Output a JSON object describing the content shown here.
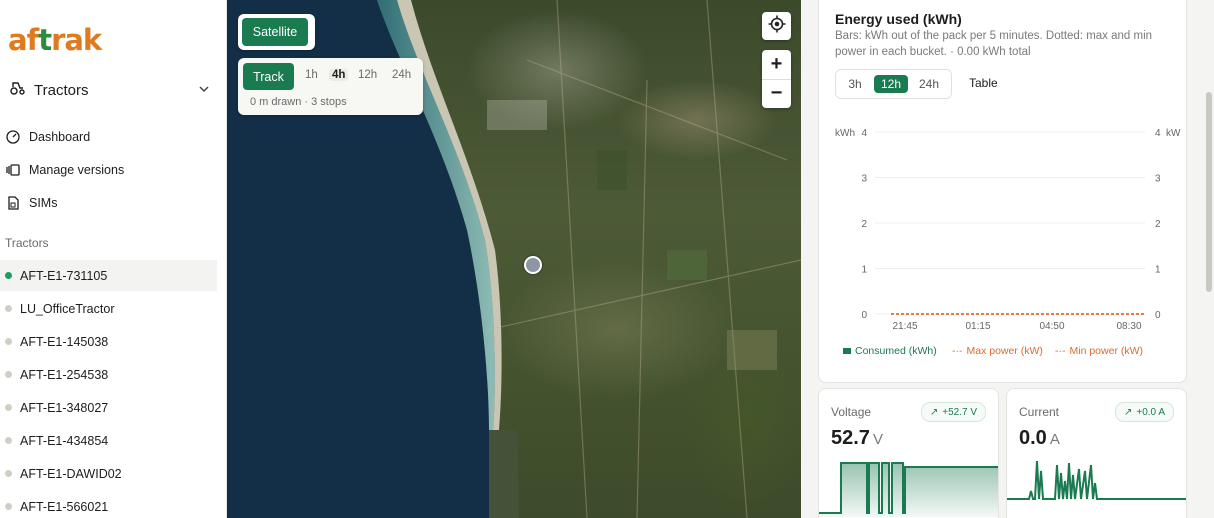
{
  "sidebar": {
    "logo": {
      "part_orange_1": "af",
      "part_green": "t",
      "part_orange_2": "rak"
    },
    "org_label": "Tractors",
    "nav": [
      {
        "label": "Dashboard",
        "icon": "speedometer-icon"
      },
      {
        "label": "Manage versions",
        "icon": "versions-icon"
      },
      {
        "label": "SIMs",
        "icon": "sim-card-icon"
      }
    ],
    "section_title": "Tractors",
    "tractors": [
      {
        "name": "AFT-E1-731105",
        "online": true,
        "selected": true
      },
      {
        "name": "LU_OfficeTractor",
        "online": false
      },
      {
        "name": "AFT-E1-145038",
        "online": false
      },
      {
        "name": "AFT-E1-254538",
        "online": false
      },
      {
        "name": "AFT-E1-348027",
        "online": false
      },
      {
        "name": "AFT-E1-434854",
        "online": false
      },
      {
        "name": "AFT-E1-DAWID02",
        "online": false
      },
      {
        "name": "AFT-E1-566021",
        "online": false
      }
    ]
  },
  "map": {
    "satellite_label": "Satellite",
    "track_label": "Track",
    "ranges": [
      "1h",
      "4h",
      "12h",
      "24h"
    ],
    "selected_range": "4h",
    "track_status": "0 m drawn · 3 stops",
    "zoom_in": "+",
    "zoom_out": "−"
  },
  "energy": {
    "title": "Energy used (kWh)",
    "description": "Bars: kWh out of the pack per 5 minutes. Dotted: max and min power in each bucket. · 0.00 kWh total",
    "ranges": [
      "3h",
      "12h",
      "24h"
    ],
    "selected_range": "12h",
    "table_label": "Table",
    "chart_data": {
      "type": "bar",
      "x_ticks": [
        "21:45",
        "01:15",
        "04:50",
        "08:30"
      ],
      "ylabel_left": "kWh",
      "ylabel_right": "kW",
      "y_ticks_left": [
        "0",
        "1",
        "2",
        "3",
        "4"
      ],
      "y_ticks_right": [
        "0",
        "1",
        "2",
        "3",
        "4"
      ],
      "ylim": [
        0,
        4
      ],
      "series": [
        {
          "name": "Consumed (kWh)",
          "type": "bar",
          "color": "#1a7a50",
          "values": [
            0
          ]
        },
        {
          "name": "Max power (kW)",
          "type": "line-dotted",
          "color": "#e06b2b",
          "values": [
            0,
            0,
            0,
            0
          ]
        },
        {
          "name": "Min power (kW)",
          "type": "line-dotted",
          "color": "#e06b2b",
          "values": [
            0,
            0,
            0,
            0
          ]
        }
      ],
      "grid": true,
      "legend_position": "bottom"
    }
  },
  "metrics": {
    "voltage": {
      "label": "Voltage",
      "value": "52.7",
      "unit": "V",
      "delta": "+52.7 V"
    },
    "current": {
      "label": "Current",
      "value": "0.0",
      "unit": "A",
      "delta": "+0.0 A"
    }
  },
  "colors": {
    "accent": "#1a7a50",
    "online": "#19a05a",
    "orange": "#e06b2b"
  }
}
